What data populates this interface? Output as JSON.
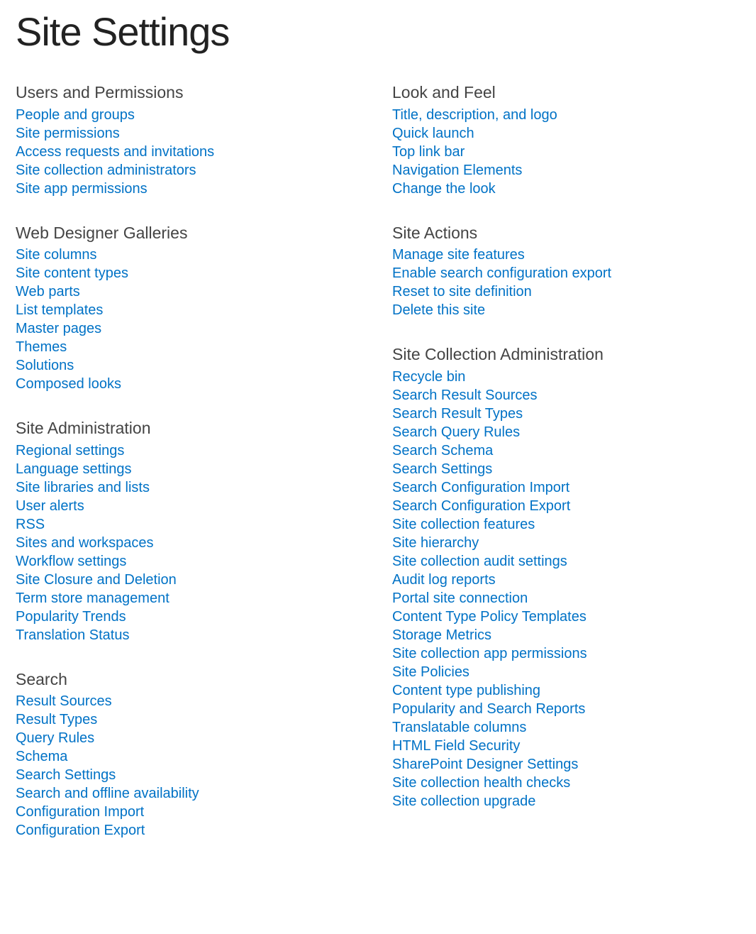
{
  "page_title": "Site Settings",
  "highlighted_link_path": "sections.7.links.8",
  "sections": [
    {
      "title": "Users and Permissions",
      "links": [
        "People and groups",
        "Site permissions",
        "Access requests and invitations",
        "Site collection administrators",
        "Site app permissions"
      ]
    },
    {
      "title": "Web Designer Galleries",
      "links": [
        "Site columns",
        "Site content types",
        "Web parts",
        "List templates",
        "Master pages",
        "Themes",
        "Solutions",
        "Composed looks"
      ]
    },
    {
      "title": "Site Administration",
      "links": [
        "Regional settings",
        "Language settings",
        "Site libraries and lists",
        "User alerts",
        "RSS",
        "Sites and workspaces",
        "Workflow settings",
        "Site Closure and Deletion",
        "Term store management",
        "Popularity Trends",
        "Translation Status"
      ]
    },
    {
      "title": "Search",
      "links": [
        "Result Sources",
        "Result Types",
        "Query Rules",
        "Schema",
        "Search Settings",
        "Search and offline availability",
        "Configuration Import",
        "Configuration Export"
      ]
    },
    {
      "title": "Look and Feel",
      "links": [
        "Title, description, and logo",
        "Quick launch",
        "Top link bar",
        "Navigation Elements",
        "Change the look"
      ]
    },
    {
      "title": "Site Actions",
      "links": [
        "Manage site features",
        "Enable search configuration export",
        "Reset to site definition",
        "Delete this site"
      ]
    },
    {
      "title": "Site Collection Administration",
      "links": [
        "Recycle bin",
        "Search Result Sources",
        "Search Result Types",
        "Search Query Rules",
        "Search Schema",
        "Search Settings",
        "Search Configuration Import",
        "Search Configuration Export",
        "Site collection features",
        "Site hierarchy",
        "Site collection audit settings",
        "Audit log reports",
        "Portal site connection",
        "Content Type Policy Templates",
        "Storage Metrics",
        "Site collection app permissions",
        "Site Policies",
        "Content type publishing",
        "Popularity and Search Reports",
        "Translatable columns",
        "HTML Field Security",
        "SharePoint Designer Settings",
        "Site collection health checks",
        "Site collection upgrade"
      ]
    }
  ]
}
